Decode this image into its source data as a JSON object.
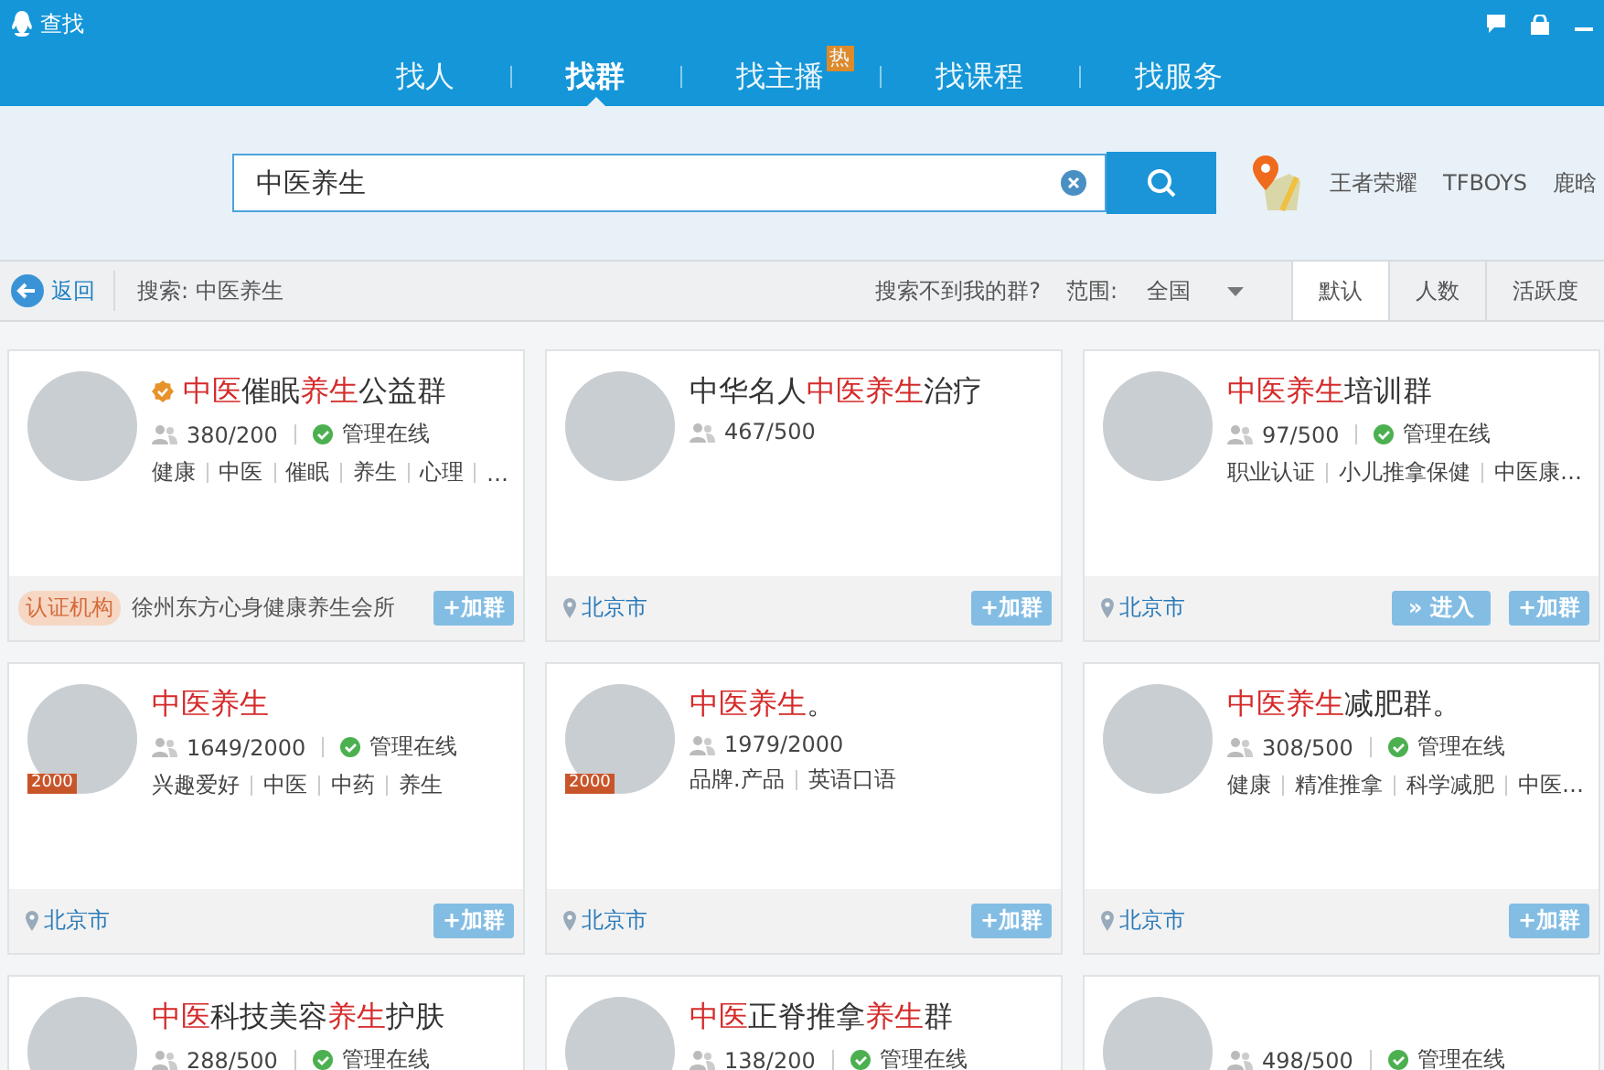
{
  "window": {
    "title": "查找"
  },
  "tabs": [
    {
      "label": "找人",
      "selected": false
    },
    {
      "label": "找群",
      "selected": true
    },
    {
      "label": "找主播",
      "selected": false,
      "badge": "热"
    },
    {
      "label": "找课程",
      "selected": false
    },
    {
      "label": "找服务",
      "selected": false
    }
  ],
  "search": {
    "value": "中医养生"
  },
  "hot_links": [
    "王者荣耀",
    "TFBOYS",
    "鹿晗"
  ],
  "toolbar": {
    "back": "返回",
    "query": "搜索: 中医养生",
    "help_link": "搜索不到我的群?",
    "scope_label": "范围:",
    "scope_value": "全国",
    "sort_tabs": [
      {
        "label": "默认",
        "selected": true
      },
      {
        "label": "人数",
        "selected": false
      },
      {
        "label": "活跃度",
        "selected": false
      }
    ]
  },
  "groups": [
    {
      "verified": true,
      "title": [
        {
          "text": "中医",
          "highlight": true
        },
        {
          "text": "催眠",
          "highlight": false
        },
        {
          "text": "养生",
          "highlight": true
        },
        {
          "text": "公益群",
          "highlight": false
        }
      ],
      "members": "380/200",
      "admin": "管理在线",
      "tags": [
        "健康",
        "中医",
        "催眠",
        "养生",
        "心理",
        "…"
      ],
      "cert_tag": "认证机构",
      "org": "徐州东方心身健康养生会所",
      "buttons": [
        {
          "kind": "join",
          "label": "+加群"
        }
      ]
    },
    {
      "verified": false,
      "title": [
        {
          "text": "中华名人",
          "highlight": false
        },
        {
          "text": "中医养生",
          "highlight": true
        },
        {
          "text": "治疗",
          "highlight": false
        }
      ],
      "members": "467/500",
      "location": "北京市",
      "buttons": [
        {
          "kind": "join",
          "label": "+加群"
        }
      ]
    },
    {
      "verified": false,
      "title": [
        {
          "text": "中医养生",
          "highlight": true
        },
        {
          "text": "培训群",
          "highlight": false
        }
      ],
      "members": "97/500",
      "admin": "管理在线",
      "tags": [
        "职业认证",
        "小儿推拿保健",
        "中医康…"
      ],
      "location": "北京市",
      "buttons": [
        {
          "kind": "enter",
          "label": "» 进入"
        },
        {
          "kind": "join",
          "label": "+加群"
        }
      ]
    },
    {
      "verified": false,
      "title": [
        {
          "text": "中医养生",
          "highlight": true
        }
      ],
      "level_badge": "2000",
      "members": "1649/2000",
      "admin": "管理在线",
      "tags": [
        "兴趣爱好",
        "中医",
        "中药",
        "养生"
      ],
      "location": "北京市",
      "buttons": [
        {
          "kind": "join",
          "label": "+加群"
        }
      ]
    },
    {
      "verified": false,
      "title": [
        {
          "text": "中医养生",
          "highlight": true
        },
        {
          "text": "。",
          "highlight": false
        }
      ],
      "level_badge": "2000",
      "members": "1979/2000",
      "tags": [
        "品牌.产品",
        "英语口语"
      ],
      "location": "北京市",
      "buttons": [
        {
          "kind": "join",
          "label": "+加群"
        }
      ]
    },
    {
      "verified": false,
      "title": [
        {
          "text": "中医养生",
          "highlight": true
        },
        {
          "text": "减肥群。",
          "highlight": false
        }
      ],
      "members": "308/500",
      "admin": "管理在线",
      "tags": [
        "健康",
        "精准推拿",
        "科学减肥",
        "中医…"
      ],
      "location": "北京市",
      "buttons": [
        {
          "kind": "join",
          "label": "+加群"
        }
      ]
    },
    {
      "verified": false,
      "title": [
        {
          "text": "中医",
          "highlight": true
        },
        {
          "text": "科技美容",
          "highlight": false
        },
        {
          "text": "养生",
          "highlight": true
        },
        {
          "text": "护肤",
          "highlight": false
        }
      ],
      "members": "288/500",
      "admin": "管理在线"
    },
    {
      "verified": false,
      "title": [
        {
          "text": "中医",
          "highlight": true
        },
        {
          "text": "正脊推拿",
          "highlight": false
        },
        {
          "text": "养生",
          "highlight": true
        },
        {
          "text": "群",
          "highlight": false
        }
      ],
      "members": "138/200",
      "admin": "管理在线"
    },
    {
      "verified": false,
      "members": "498/500",
      "admin": "管理在线"
    }
  ]
}
